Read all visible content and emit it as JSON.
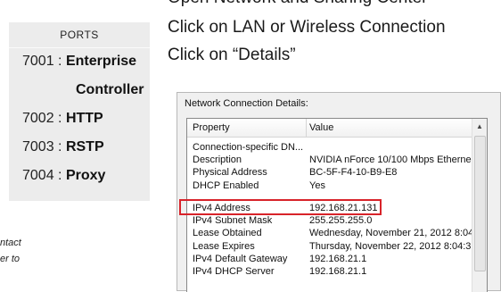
{
  "instructions": {
    "line0": "Open Network and Sharing Center",
    "line1": "Click on LAN or Wireless Connection",
    "line2": "Click on “Details”"
  },
  "ports_panel": {
    "title": "PORTS",
    "rows": [
      {
        "number": "7001 :",
        "name": "Enterprise"
      },
      {
        "number": "7002 :",
        "name": "HTTP"
      },
      {
        "number": "7003 :",
        "name": "RSTP"
      },
      {
        "number": "7004 :",
        "name": "Proxy"
      }
    ],
    "continuation": "Controller"
  },
  "side_note": {
    "line1": "ntact",
    "line2": "er to"
  },
  "dialog": {
    "title": "Network Connection Details:",
    "column_property": "Property",
    "column_value": "Value",
    "rows": [
      {
        "property": "Connection-specific DN...",
        "value": ""
      },
      {
        "property": "Description",
        "value": "NVIDIA nForce 10/100 Mbps Etherne"
      },
      {
        "property": "Physical Address",
        "value": "BC-5F-F4-10-B9-E8"
      },
      {
        "property": "DHCP Enabled",
        "value": "Yes"
      },
      {
        "property": "IPv4 Address",
        "value": "192.168.21.131"
      },
      {
        "property": "IPv4 Subnet Mask",
        "value": "255.255.255.0"
      },
      {
        "property": "Lease Obtained",
        "value": "Wednesday, November 21, 2012 8:04 ≡"
      },
      {
        "property": "Lease Expires",
        "value": "Thursday, November 22, 2012 8:04:3"
      },
      {
        "property": "IPv4 Default Gateway",
        "value": "192.168.21.1"
      },
      {
        "property": "IPv4 DHCP Server",
        "value": "192.168.21.1"
      }
    ],
    "highlight_color": "#d8232a"
  }
}
